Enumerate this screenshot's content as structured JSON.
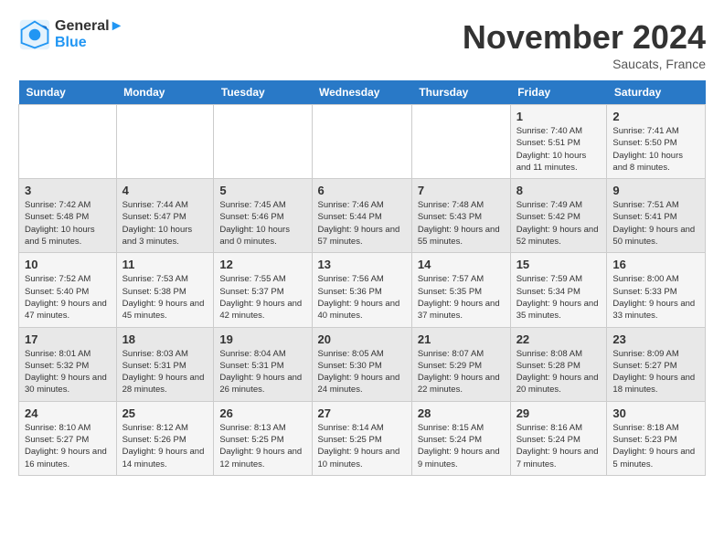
{
  "logo": {
    "line1": "General",
    "line2": "Blue"
  },
  "title": "November 2024",
  "location": "Saucats, France",
  "weekdays": [
    "Sunday",
    "Monday",
    "Tuesday",
    "Wednesday",
    "Thursday",
    "Friday",
    "Saturday"
  ],
  "weeks": [
    [
      {
        "day": "",
        "info": ""
      },
      {
        "day": "",
        "info": ""
      },
      {
        "day": "",
        "info": ""
      },
      {
        "day": "",
        "info": ""
      },
      {
        "day": "",
        "info": ""
      },
      {
        "day": "1",
        "info": "Sunrise: 7:40 AM\nSunset: 5:51 PM\nDaylight: 10 hours and 11 minutes."
      },
      {
        "day": "2",
        "info": "Sunrise: 7:41 AM\nSunset: 5:50 PM\nDaylight: 10 hours and 8 minutes."
      }
    ],
    [
      {
        "day": "3",
        "info": "Sunrise: 7:42 AM\nSunset: 5:48 PM\nDaylight: 10 hours and 5 minutes."
      },
      {
        "day": "4",
        "info": "Sunrise: 7:44 AM\nSunset: 5:47 PM\nDaylight: 10 hours and 3 minutes."
      },
      {
        "day": "5",
        "info": "Sunrise: 7:45 AM\nSunset: 5:46 PM\nDaylight: 10 hours and 0 minutes."
      },
      {
        "day": "6",
        "info": "Sunrise: 7:46 AM\nSunset: 5:44 PM\nDaylight: 9 hours and 57 minutes."
      },
      {
        "day": "7",
        "info": "Sunrise: 7:48 AM\nSunset: 5:43 PM\nDaylight: 9 hours and 55 minutes."
      },
      {
        "day": "8",
        "info": "Sunrise: 7:49 AM\nSunset: 5:42 PM\nDaylight: 9 hours and 52 minutes."
      },
      {
        "day": "9",
        "info": "Sunrise: 7:51 AM\nSunset: 5:41 PM\nDaylight: 9 hours and 50 minutes."
      }
    ],
    [
      {
        "day": "10",
        "info": "Sunrise: 7:52 AM\nSunset: 5:40 PM\nDaylight: 9 hours and 47 minutes."
      },
      {
        "day": "11",
        "info": "Sunrise: 7:53 AM\nSunset: 5:38 PM\nDaylight: 9 hours and 45 minutes."
      },
      {
        "day": "12",
        "info": "Sunrise: 7:55 AM\nSunset: 5:37 PM\nDaylight: 9 hours and 42 minutes."
      },
      {
        "day": "13",
        "info": "Sunrise: 7:56 AM\nSunset: 5:36 PM\nDaylight: 9 hours and 40 minutes."
      },
      {
        "day": "14",
        "info": "Sunrise: 7:57 AM\nSunset: 5:35 PM\nDaylight: 9 hours and 37 minutes."
      },
      {
        "day": "15",
        "info": "Sunrise: 7:59 AM\nSunset: 5:34 PM\nDaylight: 9 hours and 35 minutes."
      },
      {
        "day": "16",
        "info": "Sunrise: 8:00 AM\nSunset: 5:33 PM\nDaylight: 9 hours and 33 minutes."
      }
    ],
    [
      {
        "day": "17",
        "info": "Sunrise: 8:01 AM\nSunset: 5:32 PM\nDaylight: 9 hours and 30 minutes."
      },
      {
        "day": "18",
        "info": "Sunrise: 8:03 AM\nSunset: 5:31 PM\nDaylight: 9 hours and 28 minutes."
      },
      {
        "day": "19",
        "info": "Sunrise: 8:04 AM\nSunset: 5:31 PM\nDaylight: 9 hours and 26 minutes."
      },
      {
        "day": "20",
        "info": "Sunrise: 8:05 AM\nSunset: 5:30 PM\nDaylight: 9 hours and 24 minutes."
      },
      {
        "day": "21",
        "info": "Sunrise: 8:07 AM\nSunset: 5:29 PM\nDaylight: 9 hours and 22 minutes."
      },
      {
        "day": "22",
        "info": "Sunrise: 8:08 AM\nSunset: 5:28 PM\nDaylight: 9 hours and 20 minutes."
      },
      {
        "day": "23",
        "info": "Sunrise: 8:09 AM\nSunset: 5:27 PM\nDaylight: 9 hours and 18 minutes."
      }
    ],
    [
      {
        "day": "24",
        "info": "Sunrise: 8:10 AM\nSunset: 5:27 PM\nDaylight: 9 hours and 16 minutes."
      },
      {
        "day": "25",
        "info": "Sunrise: 8:12 AM\nSunset: 5:26 PM\nDaylight: 9 hours and 14 minutes."
      },
      {
        "day": "26",
        "info": "Sunrise: 8:13 AM\nSunset: 5:25 PM\nDaylight: 9 hours and 12 minutes."
      },
      {
        "day": "27",
        "info": "Sunrise: 8:14 AM\nSunset: 5:25 PM\nDaylight: 9 hours and 10 minutes."
      },
      {
        "day": "28",
        "info": "Sunrise: 8:15 AM\nSunset: 5:24 PM\nDaylight: 9 hours and 9 minutes."
      },
      {
        "day": "29",
        "info": "Sunrise: 8:16 AM\nSunset: 5:24 PM\nDaylight: 9 hours and 7 minutes."
      },
      {
        "day": "30",
        "info": "Sunrise: 8:18 AM\nSunset: 5:23 PM\nDaylight: 9 hours and 5 minutes."
      }
    ]
  ]
}
